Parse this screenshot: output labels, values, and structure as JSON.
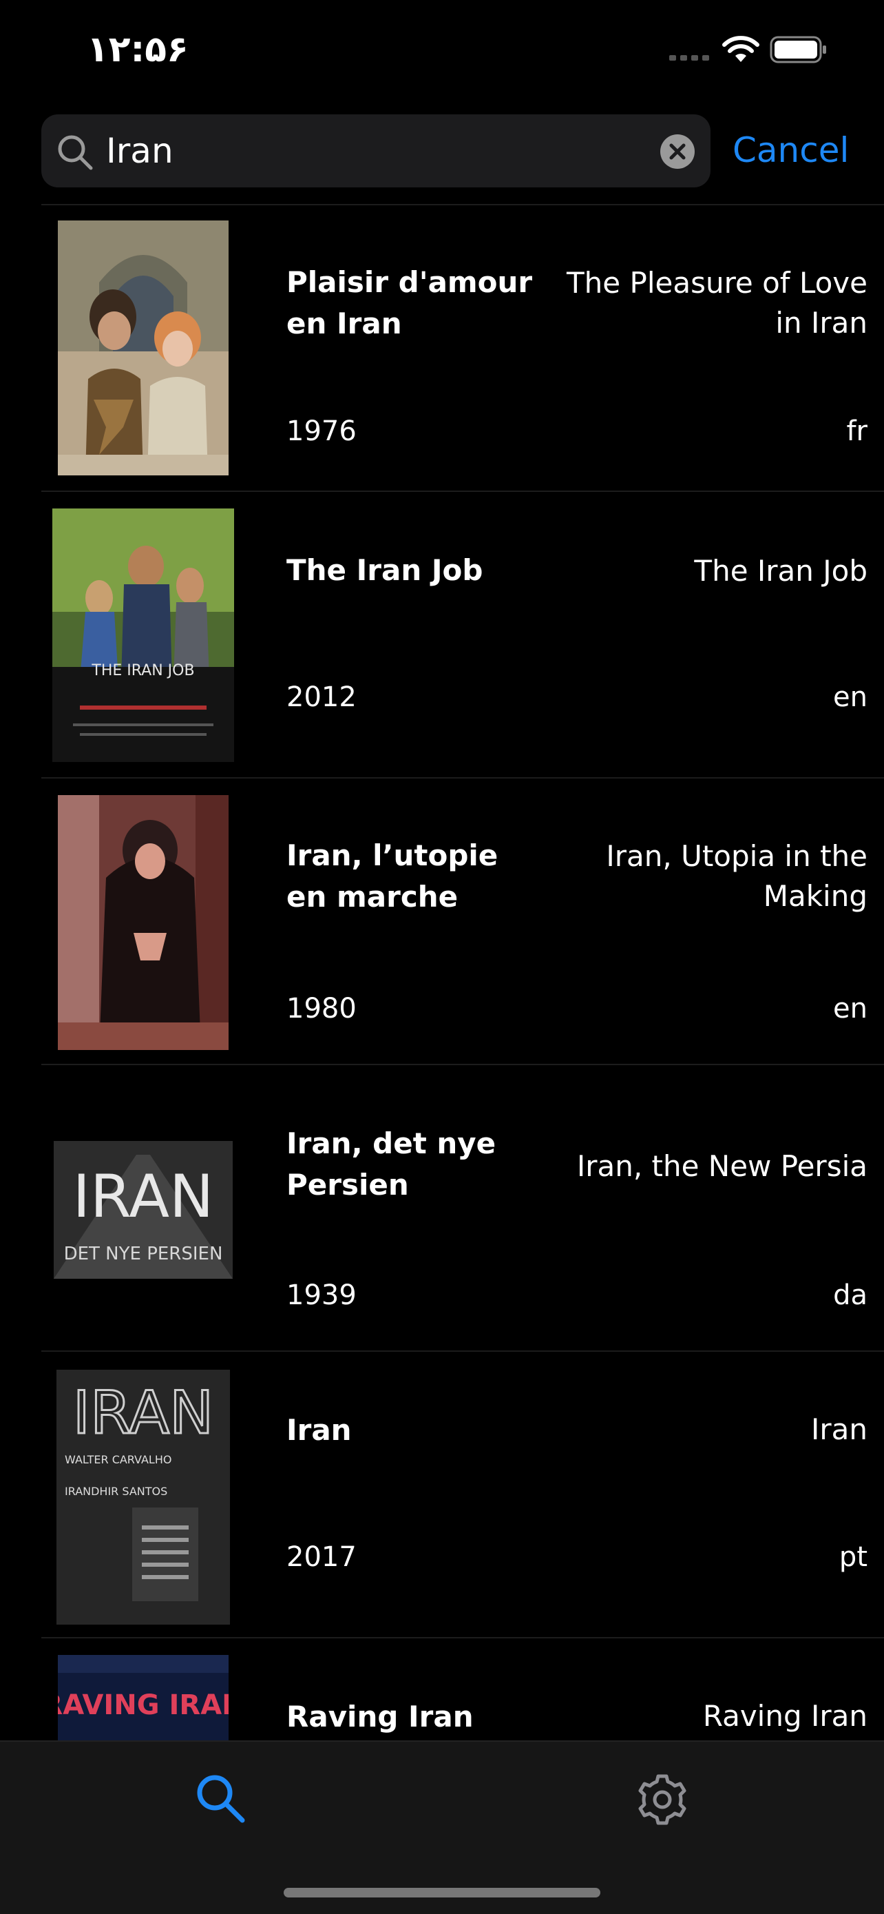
{
  "status_bar": {
    "time": "۱۲:۵۶"
  },
  "search": {
    "query": "Iran",
    "cancel_label": "Cancel"
  },
  "results": [
    {
      "title": "Plaisir d'amour en Iran",
      "original_title": "The Pleasure of Love in Iran",
      "year": "1976",
      "language": "fr"
    },
    {
      "title": "The Iran Job",
      "original_title": "The Iran Job",
      "year": "2012",
      "language": "en"
    },
    {
      "title": "Iran, l’utopie en marche",
      "original_title": "Iran, Utopia in the Making",
      "year": "1980",
      "language": "en"
    },
    {
      "title": "Iran, det nye Persien",
      "original_title": "Iran, the New Persia",
      "year": "1939",
      "language": "da"
    },
    {
      "title": "Iran",
      "original_title": "Iran",
      "year": "2017",
      "language": "pt"
    },
    {
      "title": "Raving Iran",
      "original_title": "Raving Iran",
      "year": "",
      "language": ""
    }
  ],
  "posters": {
    "p2_text": "THE IRAN JOB",
    "p4_big": "IRAN",
    "p4_small": "DET NYE PERSIEN",
    "p5_big": "IRAN",
    "p5_credit1": "WALTER CARVALHO",
    "p5_credit2": "IRANDHIR SANTOS",
    "p6_text": "RAVING IRAN"
  },
  "tabs": [
    "search",
    "settings"
  ],
  "colors": {
    "accent": "#1e88f5",
    "background": "#000000",
    "tab_bar": "#161616"
  }
}
